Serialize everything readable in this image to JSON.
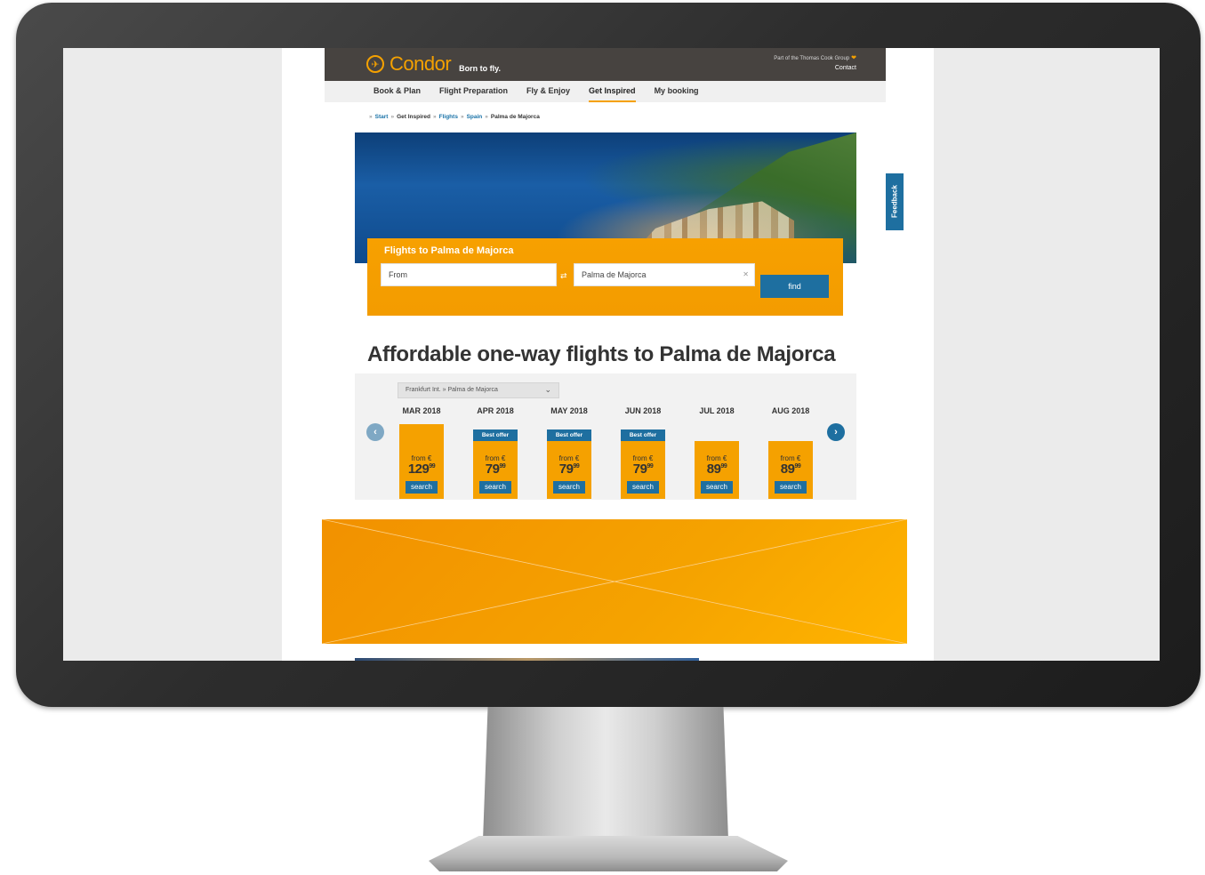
{
  "header": {
    "brand": "Condor",
    "tagline": "Born to fly.",
    "group_text": "Part of the Thomas Cook Group",
    "contact": "Contact"
  },
  "nav": {
    "items": [
      {
        "label": "Book & Plan"
      },
      {
        "label": "Flight Preparation"
      },
      {
        "label": "Fly & Enjoy"
      },
      {
        "label": "Get Inspired"
      },
      {
        "label": "My booking"
      }
    ],
    "active": "Get Inspired"
  },
  "breadcrumb": {
    "start": "Start",
    "get_inspired": "Get Inspired",
    "flights": "Flights",
    "spain": "Spain",
    "current": "Palma de Majorca"
  },
  "search": {
    "title": "Flights to Palma de Majorca",
    "from_placeholder": "From",
    "to_value": "Palma de Majorca",
    "find_label": "find"
  },
  "section_title": "Affordable one-way flights to Palma de Majorca",
  "fares": {
    "route": "Frankfurt Int. » Palma de Majorca",
    "from_label": "from €",
    "best_offer_label": "Best offer",
    "search_label": "search",
    "months": [
      {
        "label": "MAR 2018",
        "price_main": "129",
        "price_cents": "99",
        "best_offer": false,
        "level": 1.0
      },
      {
        "label": "APR 2018",
        "price_main": "79",
        "price_cents": "99",
        "best_offer": true,
        "level": 0.77
      },
      {
        "label": "MAY 2018",
        "price_main": "79",
        "price_cents": "99",
        "best_offer": true,
        "level": 0.77
      },
      {
        "label": "JUN 2018",
        "price_main": "79",
        "price_cents": "99",
        "best_offer": true,
        "level": 0.77
      },
      {
        "label": "JUL 2018",
        "price_main": "89",
        "price_cents": "99",
        "best_offer": false,
        "level": 0.77
      },
      {
        "label": "AUG 2018",
        "price_main": "89",
        "price_cents": "99",
        "best_offer": false,
        "level": 0.77
      }
    ]
  },
  "feedback": "Feedback",
  "colors": {
    "brand_orange": "#f5a100",
    "accent_blue": "#1e6fa0",
    "header_dark": "#474340"
  }
}
